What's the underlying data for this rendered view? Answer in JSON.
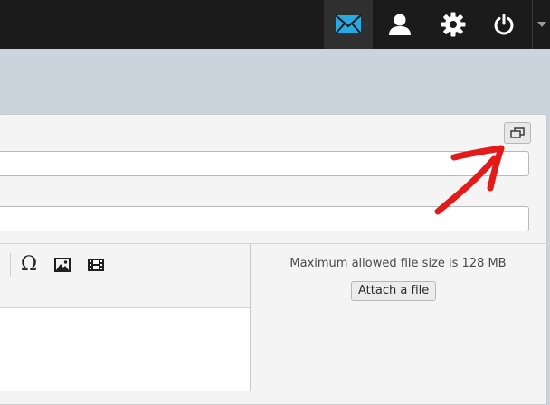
{
  "topbar": {
    "items": [
      {
        "name": "mail",
        "icon": "envelope-icon",
        "active": true,
        "accent": "#27a9e3"
      },
      {
        "name": "profile",
        "icon": "user-icon",
        "active": false
      },
      {
        "name": "settings",
        "icon": "gear-icon",
        "active": false
      },
      {
        "name": "logout",
        "icon": "power-icon",
        "active": false
      }
    ],
    "menu_caret_icon": "caret-down-icon"
  },
  "compose": {
    "popout_icon": "popout-window-icon",
    "to_value": "",
    "subject_value": ""
  },
  "editor": {
    "toolbar": [
      {
        "name": "special-character",
        "glyph": "Ω"
      },
      {
        "name": "insert-image",
        "icon": "image-icon"
      },
      {
        "name": "insert-media",
        "icon": "film-icon"
      }
    ]
  },
  "attachments": {
    "max_size_text": "Maximum allowed file size is 128 MB",
    "attach_label": "Attach a file"
  },
  "annotation": {
    "color": "#e21a1a",
    "icon": "red-arrow-annotation"
  }
}
